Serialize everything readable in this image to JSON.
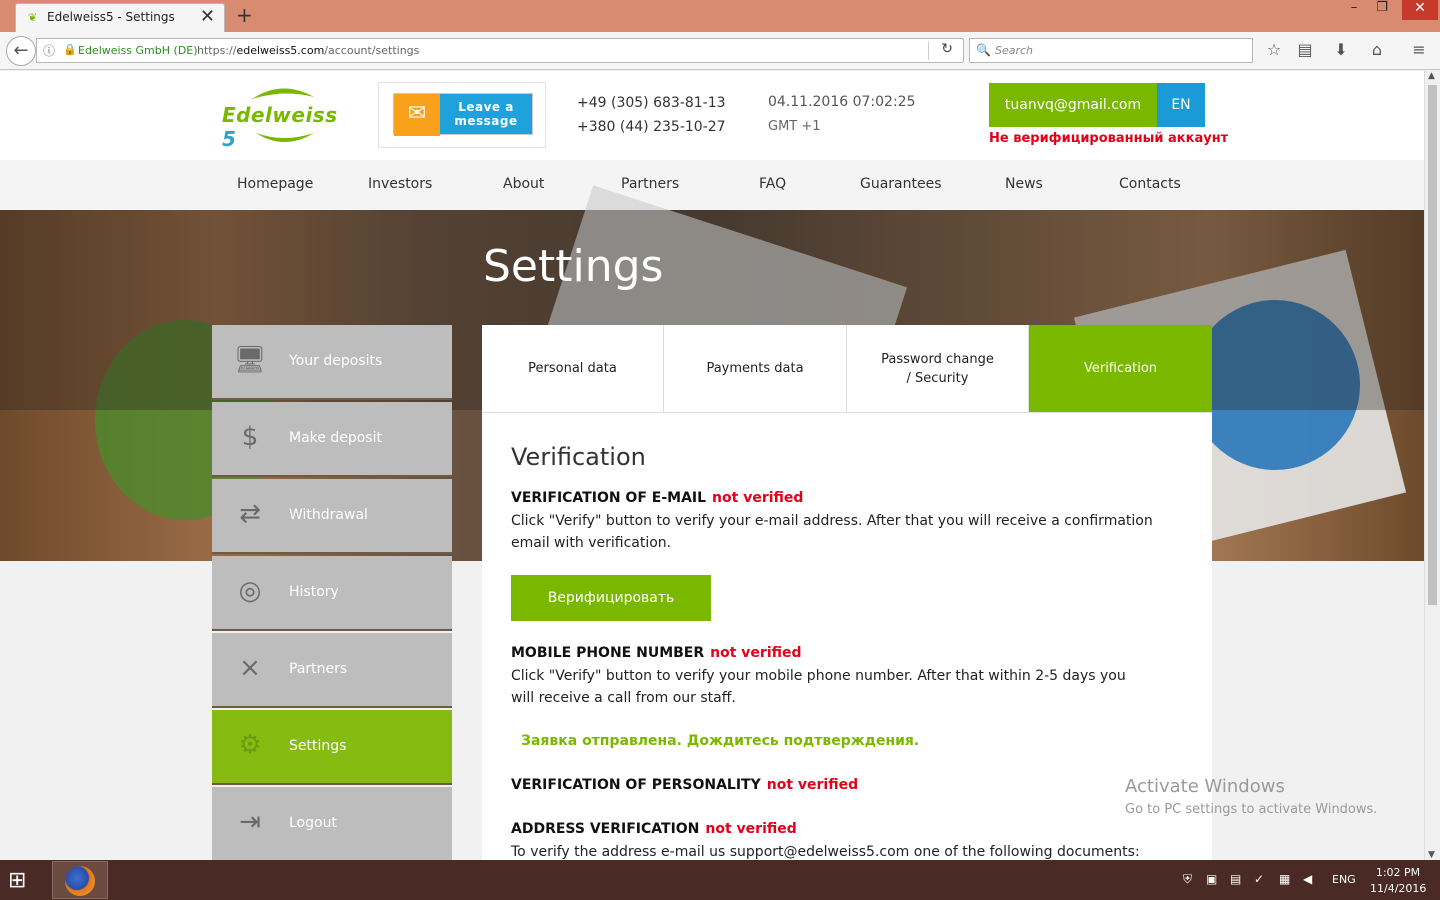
{
  "browser": {
    "tab_title": "Edelweiss5 - Settings",
    "tab_close": "✕",
    "new_tab": "+",
    "window_buttons": {
      "minimize": "–",
      "maximize": "❐",
      "close": "✕"
    },
    "url_org": "Edelweiss GmbH (DE)",
    "url_scheme": "https://",
    "url_domain": "edelweiss5.com",
    "url_path": "/account/settings",
    "search_placeholder": "Search"
  },
  "header": {
    "logo_main": "Edelweiss",
    "logo_num": " 5",
    "leave_message": "Leave a message",
    "phone1": "+49 (305) 683-81-13",
    "phone2": "+380 (44) 235-10-27",
    "datetime": "04.11.2016 07:02:25",
    "timezone": "GMT +1",
    "user_email": "tuanvq@gmail.com",
    "language": "EN",
    "unverified_notice": "Не верифицированный аккаунт"
  },
  "menu": [
    "Homepage",
    "Investors",
    "About",
    "Partners",
    "FAQ",
    "Guarantees",
    "News",
    "Contacts"
  ],
  "page_title": "Settings",
  "sidebar": [
    {
      "label": "Your deposits",
      "icon": "monitor-chart-icon",
      "active": false
    },
    {
      "label": "Make deposit",
      "icon": "money-plant-icon",
      "active": false
    },
    {
      "label": "Withdrawal",
      "icon": "dollar-arrows-icon",
      "active": false
    },
    {
      "label": "History",
      "icon": "coins-icon",
      "active": false
    },
    {
      "label": "Partners",
      "icon": "partners-strategy-icon",
      "active": false
    },
    {
      "label": "Settings",
      "icon": "gear-dollar-icon",
      "active": true
    },
    {
      "label": "Logout",
      "icon": "logout-icon",
      "active": false
    }
  ],
  "settings_tabs": [
    {
      "label": "Personal data",
      "active": false
    },
    {
      "label": "Payments data",
      "active": false
    },
    {
      "label": "Password change / Security",
      "active": false
    },
    {
      "label": "Verification",
      "active": true
    }
  ],
  "verification": {
    "heading": "Verification",
    "email_title": "VERIFICATION OF E-MAIL",
    "email_status": "not verified",
    "email_text": "Click \"Verify\" button to verify your e-mail address. After that you will receive a confirmation email with verification.",
    "verify_button": "Верифицировать",
    "phone_title": "MOBILE PHONE NUMBER",
    "phone_status": "not verified",
    "phone_text": "Click \"Verify\" button to verify your mobile phone number. After that within 2-5 days you will receive a call from our staff.",
    "request_sent": "Заявка отправлена. Дождитесь подтверждения.",
    "personality_title": "VERIFICATION OF PERSONALITY",
    "personality_status": "not verified",
    "address_title": "ADDRESS VERIFICATION",
    "address_status": "not verified",
    "address_text": "To verify the address e-mail us support@edelweiss5.com one of the following documents:"
  },
  "watermark": {
    "line1": "Activate Windows",
    "line2": "Go to PC settings to activate Windows."
  },
  "taskbar": {
    "language": "ENG",
    "time": "1:02 PM",
    "date": "11/4/2016"
  },
  "colors": {
    "accent_green": "#7ab800",
    "accent_blue": "#1a9ad6",
    "error_red": "#e3001b"
  }
}
